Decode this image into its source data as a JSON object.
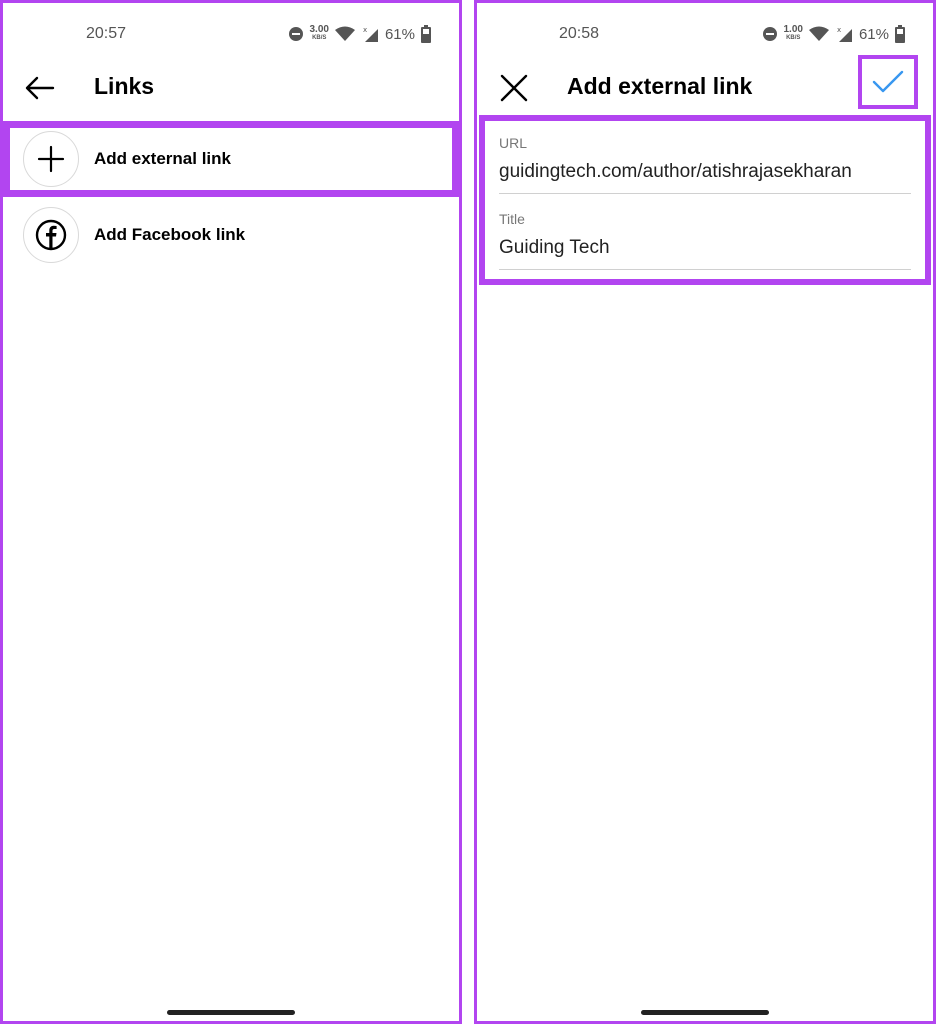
{
  "left": {
    "status": {
      "time": "20:57",
      "speed_value": "3.00",
      "speed_unit": "KB/S",
      "battery": "61%"
    },
    "app_bar": {
      "title": "Links"
    },
    "list": [
      {
        "label": "Add external link",
        "icon": "plus-icon"
      },
      {
        "label": "Add Facebook link",
        "icon": "facebook-icon"
      }
    ]
  },
  "right": {
    "status": {
      "time": "20:58",
      "speed_value": "1.00",
      "speed_unit": "KB/S",
      "battery": "61%"
    },
    "app_bar": {
      "title": "Add external link"
    },
    "form": {
      "url_label": "URL",
      "url_value": "guidingtech.com/author/atishrajasekharan",
      "title_label": "Title",
      "title_value": "Guiding Tech"
    }
  },
  "colors": {
    "highlight": "#b245f0",
    "accent": "#3897f0"
  }
}
